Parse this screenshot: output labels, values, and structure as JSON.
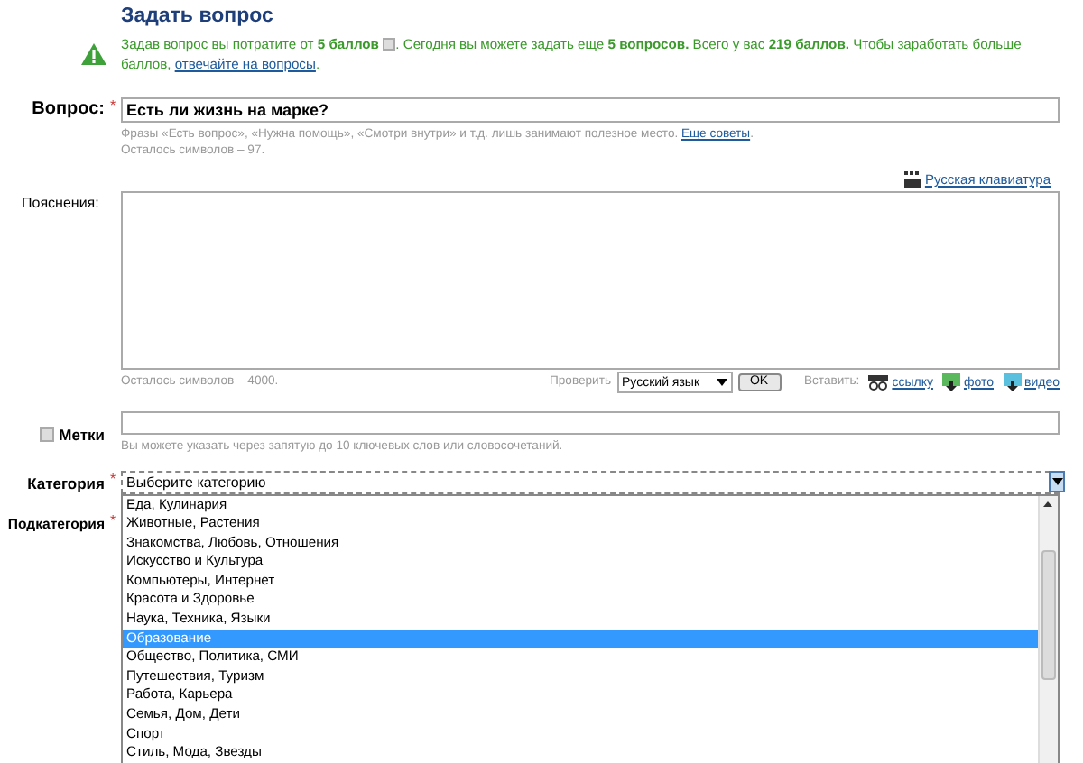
{
  "title": "Задать вопрос",
  "required_mark": "*",
  "notice": {
    "before": "Задав вопрос вы потратите от **5 баллов**",
    "after": ". Сегодня вы можете задать еще **5 вопросов.** Всего у вас **219 баллов.** Чтобы заработать больше баллов, ",
    "link": "отвечайте на вопросы",
    "tail": "."
  },
  "question": {
    "label": "Вопрос:",
    "required": true,
    "value": "Есть ли жизнь на марке?",
    "hint": "Фразы «Есть вопрос», «Нужна помощь», «Смотри внутри» и т.д. лишь занимают полезное место. ",
    "hint_link": "Еще советы",
    "hint_tail": ".",
    "counter": "Осталось символов – 97."
  },
  "keyboard_link": "Русская клавиатура",
  "details": {
    "label": "Пояснения:",
    "counter": "Осталось символов – 4000.",
    "check_label": "Проверить",
    "language": "Русский язык",
    "ok": "OK",
    "insert_label": "Вставить:",
    "insert": [
      {
        "kind": "link",
        "label": "ссылку"
      },
      {
        "kind": "photo",
        "label": "фото"
      },
      {
        "kind": "video",
        "label": "видео"
      }
    ]
  },
  "tags": {
    "label": "Метки",
    "checked": false,
    "hint": "Вы можете указать через запятую до 10 ключевых слов или словосочетаний."
  },
  "category": {
    "label": "Категория",
    "required": true,
    "value": "Выберите категорию",
    "options": [
      {
        "label": "Еда, Кулинария",
        "selected": false
      },
      {
        "label": "Животные, Растения",
        "selected": false
      },
      {
        "label": "Знакомства, Любовь, Отношения",
        "selected": false
      },
      {
        "label": "Искусство и Культура",
        "selected": false
      },
      {
        "label": "Компьютеры, Интернет",
        "selected": false
      },
      {
        "label": "Красота и Здоровье",
        "selected": false
      },
      {
        "label": "Наука, Техника, Языки",
        "selected": false
      },
      {
        "label": "Образование",
        "selected": true
      },
      {
        "label": "Общество, Политика, СМИ",
        "selected": false
      },
      {
        "label": "Путешествия, Туризм",
        "selected": false
      },
      {
        "label": "Работа, Карьера",
        "selected": false
      },
      {
        "label": "Семья, Дом, Дети",
        "selected": false
      },
      {
        "label": "Спорт",
        "selected": false
      },
      {
        "label": "Стиль, Мода, Звезды",
        "selected": false
      }
    ]
  },
  "subcategory": {
    "label": "Подкатегория",
    "required": true
  }
}
